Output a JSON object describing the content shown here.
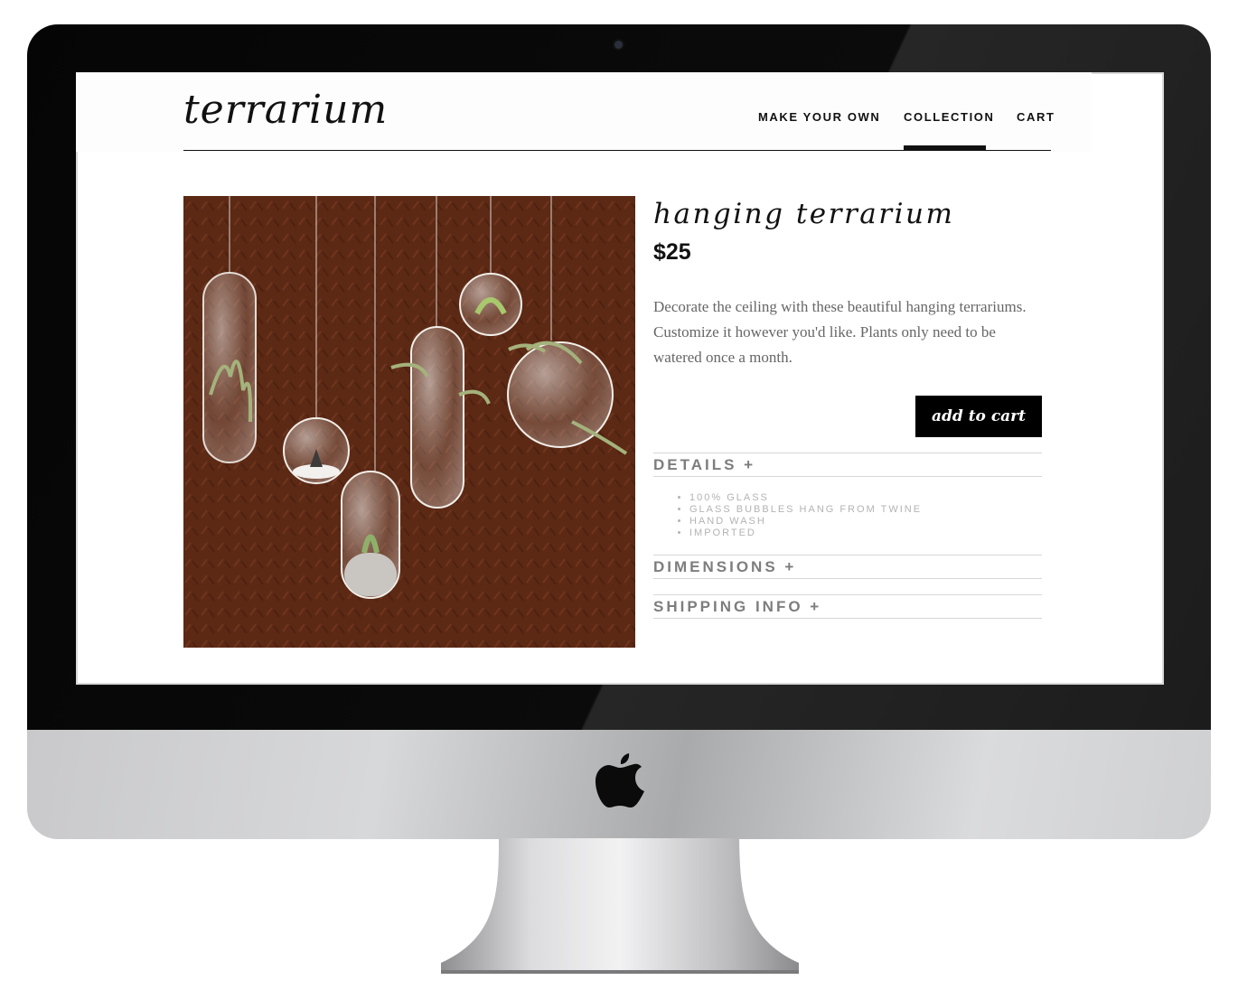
{
  "site": {
    "logo": "terrarium",
    "nav": [
      {
        "label": "MAKE YOUR OWN",
        "active": false
      },
      {
        "label": "COLLECTION",
        "active": true
      },
      {
        "label": "CART",
        "active": false
      }
    ]
  },
  "product": {
    "title": "hanging terrarium",
    "price": "$25",
    "description": "Decorate the ceiling with these beautiful hanging terrariums. Customize it however you'd like. Plants only need to be watered once a month.",
    "add_to_cart_label": "add to cart",
    "image_icon": "hanging-glass-terrariums-photo"
  },
  "accordion": {
    "details": {
      "label": "DETAILS +",
      "items": [
        "100% GLASS",
        "GLASS BUBBLES HANG FROM TWINE",
        "HAND WASH",
        "IMPORTED"
      ]
    },
    "dimensions": {
      "label": "DIMENSIONS +"
    },
    "shipping": {
      "label": "SHIPPING INFO +"
    }
  },
  "device": {
    "icon": "apple-logo-icon"
  },
  "colors": {
    "accent": "#000000",
    "accordion_text": "#7d7d7d",
    "detail_text": "#b3b3b3",
    "image_background": "#5f2a16"
  }
}
